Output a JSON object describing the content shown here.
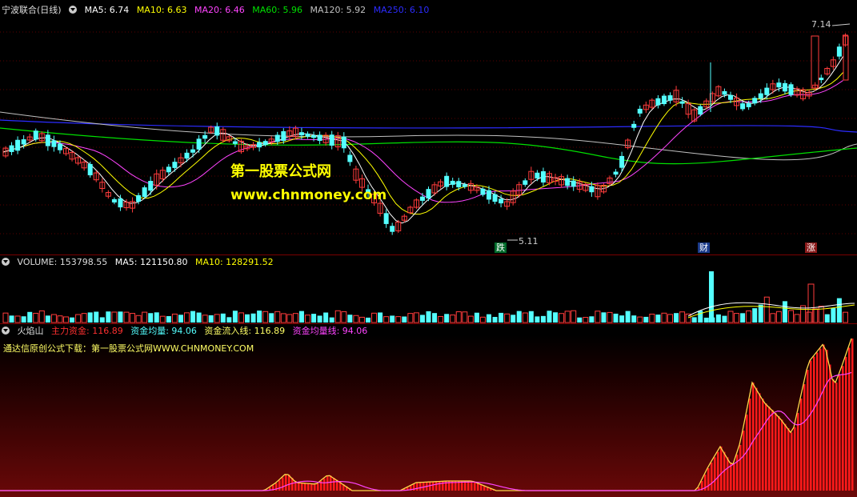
{
  "price_header": {
    "title": "宁波联合(日线)",
    "ma5": "MA5: 6.74",
    "ma10": "MA10: 6.63",
    "ma20": "MA20: 6.46",
    "ma60": "MA60: 5.96",
    "ma120": "MA120: 5.92",
    "ma250": "MA250: 6.10"
  },
  "price_labels": {
    "high": "7.14",
    "low": "5.11"
  },
  "markers": {
    "die": "跌",
    "cai": "财",
    "zhang": "涨"
  },
  "watermark": {
    "line1": "第一股票公式网",
    "line2": "www.chnmoney.com"
  },
  "volume_header": {
    "name": "VOLUME: 153798.55",
    "ma5": "MA5: 121150.80",
    "ma10": "MA10: 128291.52"
  },
  "indicator_header": {
    "name": "火焰山",
    "main_fund": "主力资金: 116.89",
    "fund_avg": "资金均量: 94.06",
    "inflow": "资金流入线: 116.89",
    "avg_line": "资金均量线: 94.06",
    "sub_line": "通达信原创公式下载：第一股票公式网WWW.CHNMONEY.COM"
  },
  "colors": {
    "up": "#ff3c3c",
    "down": "#54ffff",
    "ma5": "#ffffff",
    "ma10": "#ffff00",
    "ma20": "#ff44ff",
    "ma60": "#00e000",
    "ma120": "#c0c0c0",
    "ma250": "#2c2cff"
  }
}
